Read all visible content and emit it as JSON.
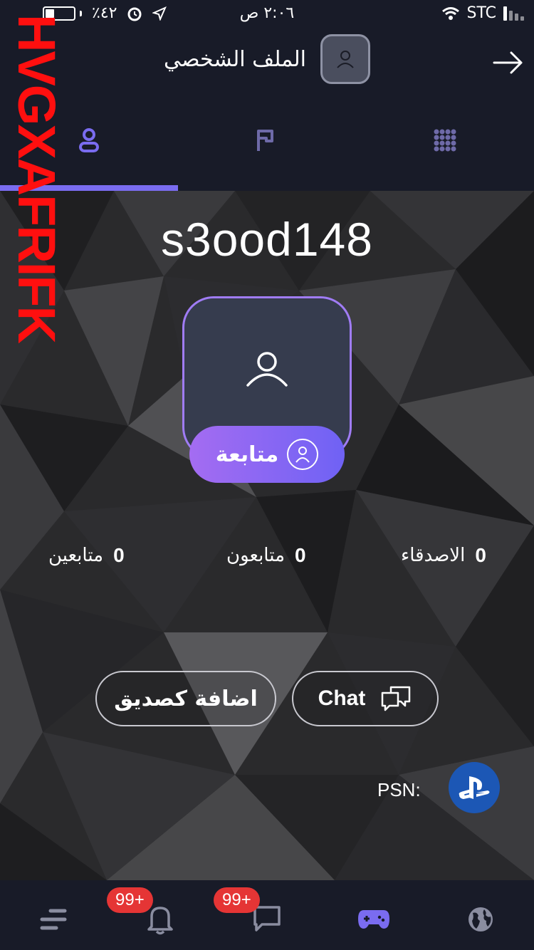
{
  "status_bar": {
    "time": "٢:٠٦ ص",
    "battery_percent": "٪٤٢",
    "carrier": "STC"
  },
  "header": {
    "title": "الملف الشخصي",
    "back_icon": "arrow-right-icon"
  },
  "tabs": [
    {
      "icon": "user-icon",
      "active": true
    },
    {
      "icon": "flag-icon",
      "active": false
    },
    {
      "icon": "grid-icon",
      "active": false
    }
  ],
  "profile": {
    "username": "s3ood148",
    "follow_label": "متابعة"
  },
  "stats": [
    {
      "value": "0",
      "label": "متابعين"
    },
    {
      "value": "0",
      "label": "متابعون"
    },
    {
      "value": "0",
      "label": "الاصدقاء"
    }
  ],
  "actions": {
    "add_friend_label": "اضافة كصديق",
    "chat_label": "Chat"
  },
  "psn": {
    "label": "PSN:"
  },
  "watermark": "HVGXAFRIFK",
  "bottom_nav": {
    "notifications_badge": "99+",
    "messages_badge": "99+"
  },
  "colors": {
    "accent": "#7a6cf0",
    "badge": "#e53535",
    "background": "#181b28"
  }
}
